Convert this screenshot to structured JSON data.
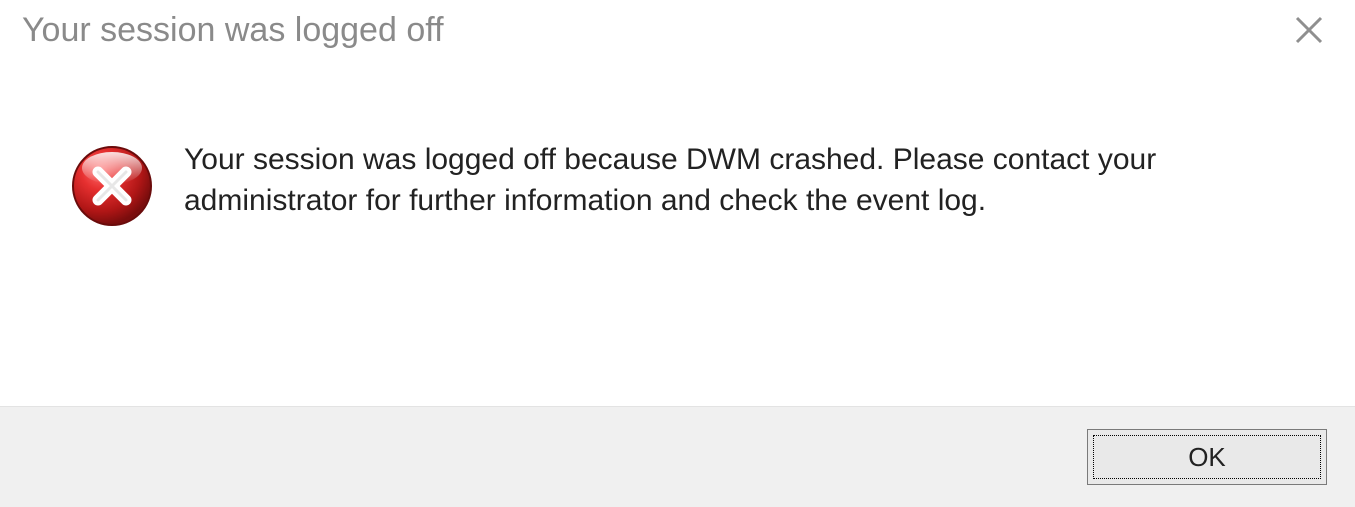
{
  "dialog": {
    "title": "Your session was logged off",
    "message": "Your session was logged off because DWM crashed. Please contact your administrator for further information and check the event log.",
    "ok_label": "OK"
  }
}
